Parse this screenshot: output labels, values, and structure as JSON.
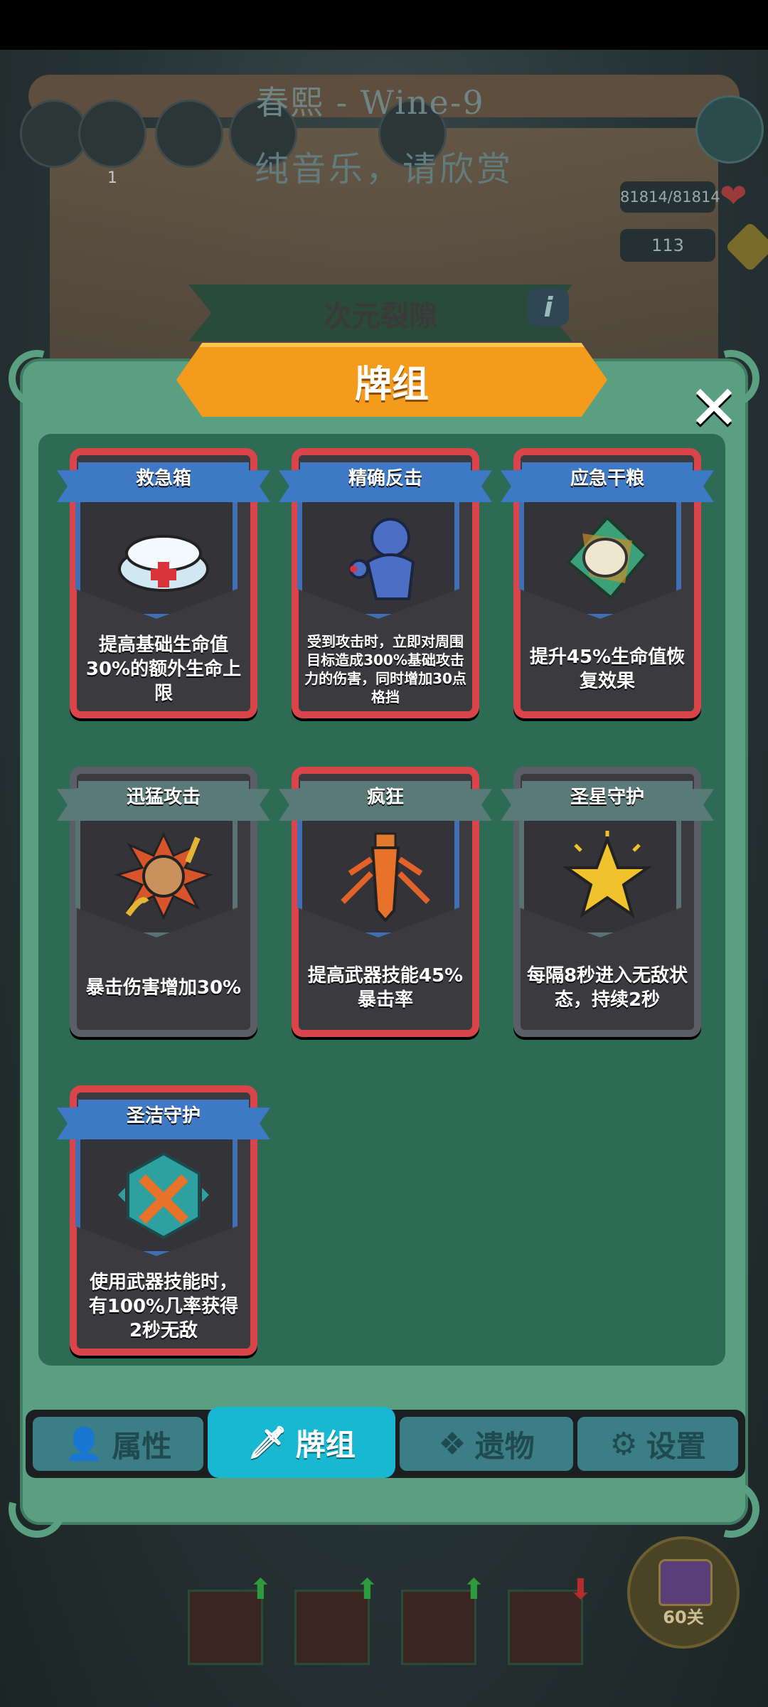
{
  "background": {
    "song_title": "春熙 - Wine-9",
    "song_subtitle": "纯音乐，请欣赏",
    "buff_count": "1",
    "hp": "81814/81814",
    "coins": "113",
    "stage_title": "次元裂隙",
    "info_label": "i",
    "level": "60关"
  },
  "dialog": {
    "title": "牌组",
    "close_label": "✕"
  },
  "cards": [
    {
      "name": "救急箱",
      "desc": "提高基础生命值30%的额外生命上限",
      "icon": "first-aid-kit-icon",
      "frame": "red",
      "ribbon": "blue"
    },
    {
      "name": "精确反击",
      "desc": "受到攻击时，立即对周围目标造成300%基础攻击力的伤害，同时增加30点格挡",
      "icon": "blue-figure-icon",
      "frame": "red",
      "ribbon": "blue"
    },
    {
      "name": "应急干粮",
      "desc": "提升45%生命值恢复效果",
      "icon": "ration-bun-icon",
      "frame": "red",
      "ribbon": "blue"
    },
    {
      "name": "迅猛攻击",
      "desc": "暴击伤害增加30%",
      "icon": "fist-strike-icon",
      "frame": "grey",
      "ribbon": "blue"
    },
    {
      "name": "疯狂",
      "desc": "提高武器技能45%暴击率",
      "icon": "frenzy-sword-icon",
      "frame": "red",
      "ribbon": "grey"
    },
    {
      "name": "圣星守护",
      "desc": "每隔8秒进入无敌状态，持续2秒",
      "icon": "gold-star-icon",
      "frame": "grey",
      "ribbon": "grey"
    },
    {
      "name": "圣洁守护",
      "desc": "使用武器技能时，有100%几率获得2秒无敌",
      "icon": "crossed-swords-shield-icon",
      "frame": "red",
      "ribbon": "blue"
    }
  ],
  "tabs": [
    {
      "label": "属性",
      "icon": "person-icon",
      "active": false
    },
    {
      "label": "牌组",
      "icon": "sword-icon",
      "active": true
    },
    {
      "label": "遗物",
      "icon": "relic-grid-icon",
      "active": false
    },
    {
      "label": "设置",
      "icon": "gear-icon",
      "active": false
    }
  ]
}
